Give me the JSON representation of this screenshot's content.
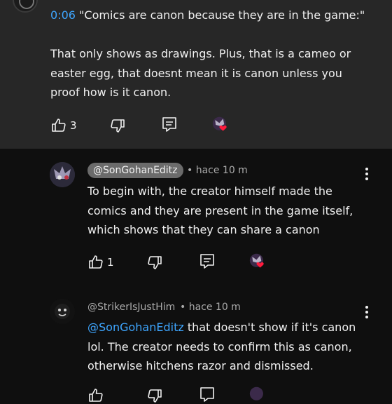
{
  "top_comment": {
    "reply": {
      "timestamp": "0:06",
      "quote": "\"Comics are canon because they are in the game:\"",
      "text": "That only shows as drawings. Plus, that is a cameo or easter egg, that doesnt mean it is canon unless you proof how is it canon."
    },
    "likes": "3"
  },
  "replies": [
    {
      "handle": "@SonGohanEditz",
      "time": "• hace 10 m",
      "text": "To begin with, the creator himself made the comics and they are present in the game itself, which shows that they can share a canon",
      "likes": "1"
    },
    {
      "handle": "@StrikerIsJustHim",
      "time": "• hace 10 m",
      "mention": "@SonGohanEditz",
      "text": " that doesn't show if it's canon lol. The creator needs to confirm this as canon, otherwise hitchens razor and dismissed."
    }
  ],
  "colors": {
    "link": "#3ea6ff",
    "heart": "#ff1a3c",
    "top_bg": "#272727",
    "page_bg": "#0f0f0f"
  },
  "icons": [
    "like-icon",
    "dislike-icon",
    "reply-icon",
    "creator-heart-icon",
    "more-vert-icon"
  ]
}
